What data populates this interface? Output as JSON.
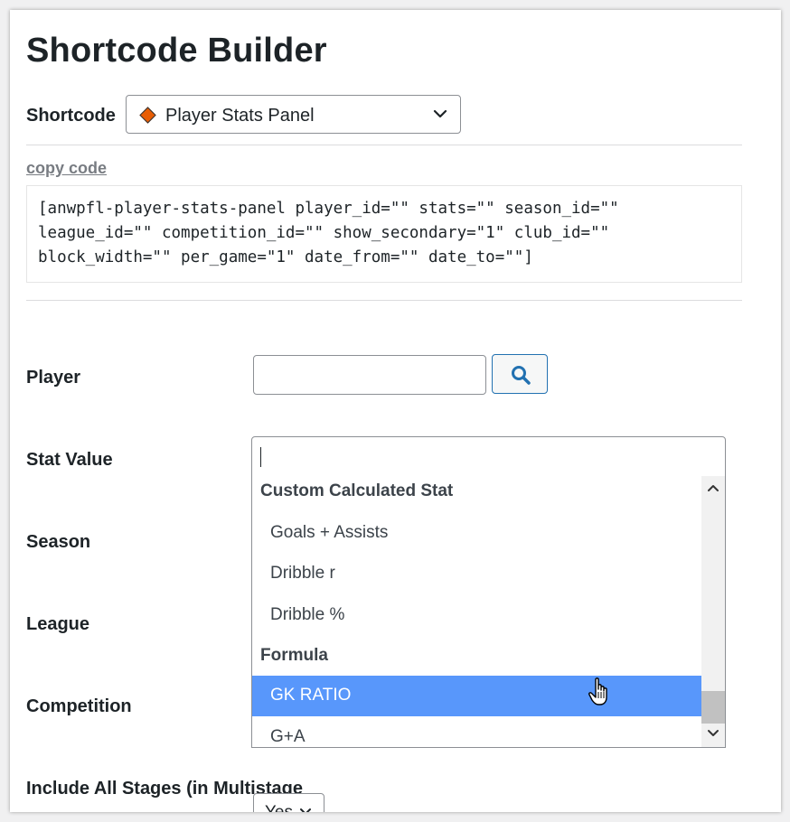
{
  "page": {
    "title": "Shortcode Builder"
  },
  "shortcode": {
    "label": "Shortcode",
    "selected": "Player Stats Panel",
    "icon": "orange-diamond-icon"
  },
  "copy_code": {
    "label": "copy code",
    "lines": [
      "[anwpfl-player-stats-panel player_id=\"\" stats=\"\" season_id=\"\"",
      "league_id=\"\" competition_id=\"\" show_secondary=\"1\" club_id=\"\"",
      "block_width=\"\" per_game=\"1\" date_from=\"\" date_to=\"\"]"
    ]
  },
  "fields": {
    "player": {
      "label": "Player",
      "value": "",
      "search_icon": "search-icon"
    },
    "stat_value": {
      "label": "Stat Value",
      "value": ""
    },
    "season": {
      "label": "Season"
    },
    "league": {
      "label": "League"
    },
    "competition": {
      "label": "Competition"
    },
    "include_all_stages": {
      "label": "Include All Stages (in Multistage",
      "selected": "Yes"
    }
  },
  "dropdown": {
    "items": [
      {
        "type": "group",
        "label": "Custom Calculated Stat"
      },
      {
        "type": "option",
        "label": "Goals + Assists"
      },
      {
        "type": "option",
        "label": "Dribble r"
      },
      {
        "type": "option",
        "label": "Dribble %"
      },
      {
        "type": "group",
        "label": "Formula"
      },
      {
        "type": "option",
        "label": "GK RATIO",
        "highlighted": true
      },
      {
        "type": "option",
        "label": "G+A"
      }
    ],
    "scroll_fraction": 0.9
  },
  "colors": {
    "accent": "#2271b1",
    "highlight": "#5897fb",
    "diamond": "#e85d04"
  }
}
